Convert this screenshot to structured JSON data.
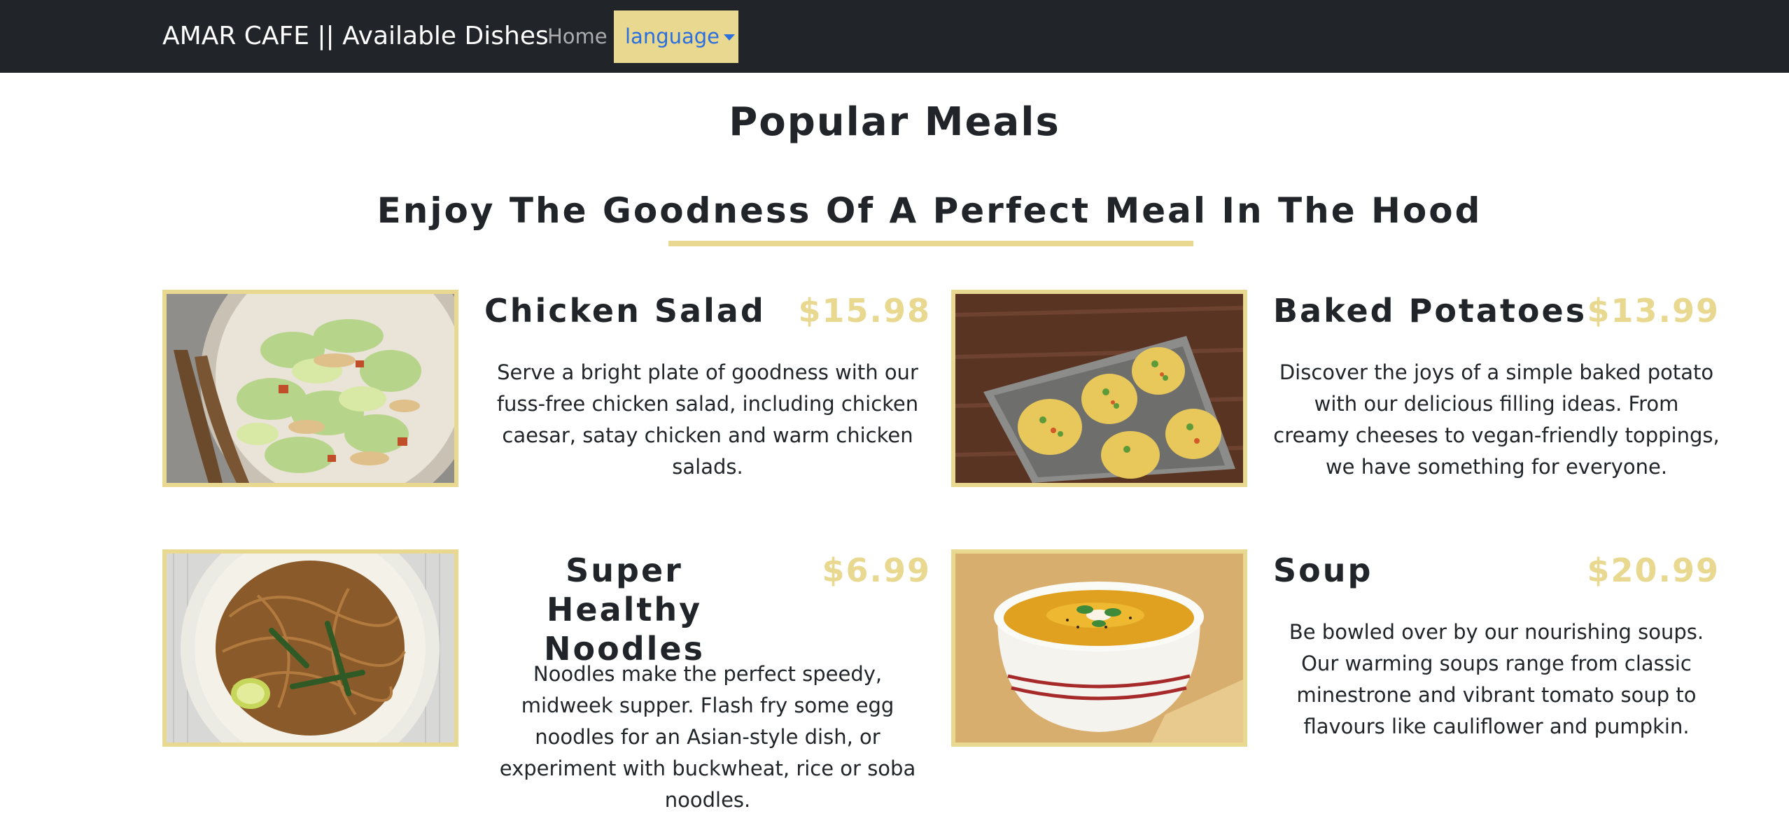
{
  "navbar": {
    "brand": "AMAR CAFE || Available Dishes",
    "home": "Home",
    "language": "language",
    "accent_color": "#e8d890",
    "link_color": "#2b6ee0"
  },
  "header": {
    "title": "Popular Meals",
    "subtitle": "Enjoy The Goodness Of A Perfect Meal In The Hood"
  },
  "meals": [
    {
      "name": "Chicken Salad",
      "price": "$15.98",
      "description": "Serve a bright plate of goodness with our fuss-free chicken salad, including chicken caesar, satay chicken and warm chicken salads.",
      "image": "chicken-salad-photo"
    },
    {
      "name": "Baked Potatoes",
      "price": "$13.99",
      "description": "Discover the joys of a simple baked potato with our delicious filling ideas. From creamy cheeses to vegan-friendly toppings, we have something for everyone.",
      "image": "baked-potatoes-photo"
    },
    {
      "name": "Super Healthy Noodles",
      "price": "$6.99",
      "description": "Noodles make the perfect speedy, midweek supper. Flash fry some egg noodles for an Asian-style dish, or experiment with buckwheat, rice or soba noodles.",
      "image": "noodles-photo"
    },
    {
      "name": "Soup",
      "price": "$20.99",
      "description": "Be bowled over by our nourishing soups. Our warming soups range from classic minestrone and vibrant tomato soup to flavours like cauliflower and pumpkin.",
      "image": "soup-photo"
    }
  ]
}
